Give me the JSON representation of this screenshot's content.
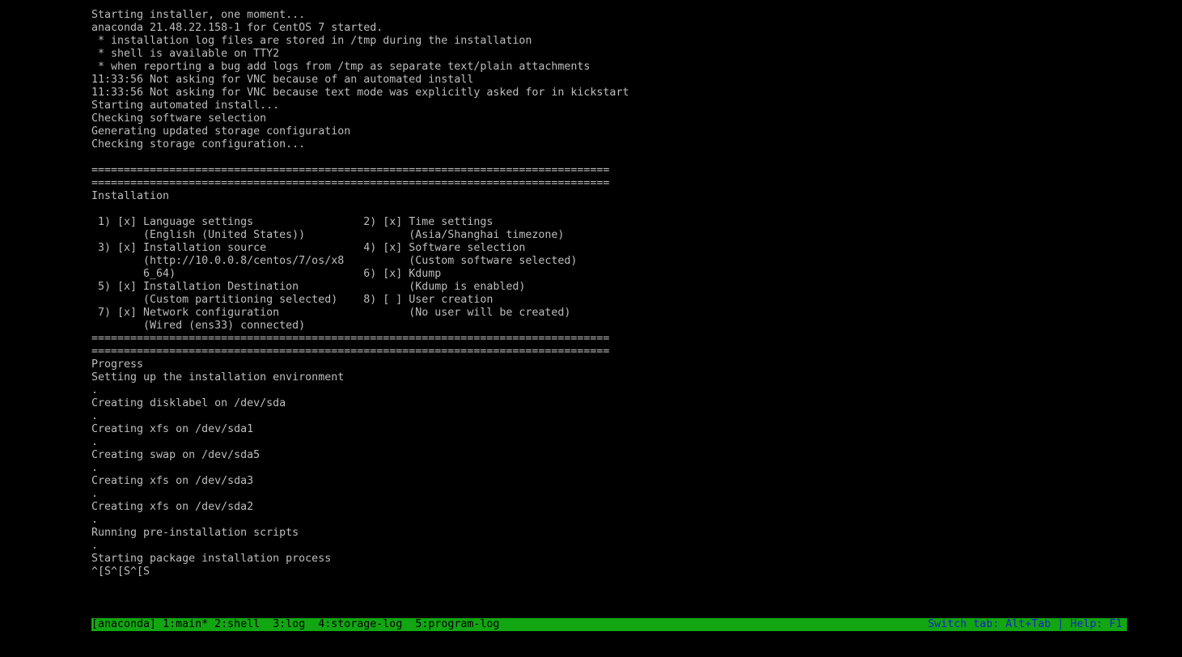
{
  "terminal": {
    "lines": [
      "Starting installer, one moment...",
      "anaconda 21.48.22.158-1 for CentOS 7 started.",
      " * installation log files are stored in /tmp during the installation",
      " * shell is available on TTY2",
      " * when reporting a bug add logs from /tmp as separate text/plain attachments",
      "11:33:56 Not asking for VNC because of an automated install",
      "11:33:56 Not asking for VNC because text mode was explicitly asked for in kickstart",
      "Starting automated install...",
      "Checking software selection",
      "Generating updated storage configuration",
      "Checking storage configuration...",
      "",
      "================================================================================",
      "================================================================================",
      "Installation",
      "",
      " 1) [x] Language settings                 2) [x] Time settings",
      "        (English (United States))                (Asia/Shanghai timezone)",
      " 3) [x] Installation source               4) [x] Software selection",
      "        (http://10.0.0.8/centos/7/os/x8          (Custom software selected)",
      "        6_64)                             6) [x] Kdump",
      " 5) [x] Installation Destination                 (Kdump is enabled)",
      "        (Custom partitioning selected)    8) [ ] User creation",
      " 7) [x] Network configuration                    (No user will be created)",
      "        (Wired (ens33) connected)",
      "================================================================================",
      "================================================================================",
      "Progress",
      "Setting up the installation environment",
      ".",
      "Creating disklabel on /dev/sda",
      ".",
      "Creating xfs on /dev/sda1",
      ".",
      "Creating swap on /dev/sda5",
      ".",
      "Creating xfs on /dev/sda3",
      ".",
      "Creating xfs on /dev/sda2",
      ".",
      "Running pre-installation scripts",
      ".",
      "Starting package installation process",
      "^[S^[S^[S"
    ]
  },
  "statusbar": {
    "session": "[anaconda]",
    "tabs": [
      "1:main*",
      "2:shell",
      "3:log",
      "4:storage-log",
      "5:program-log"
    ],
    "help": "Switch tab: Alt+Tab | Help: F1"
  },
  "colors": {
    "background": "#000000",
    "text": "#bdbdbd",
    "statusbar_bg": "#12a612",
    "statusbar_text": "#000000",
    "help_text": "#1e1ec8"
  }
}
